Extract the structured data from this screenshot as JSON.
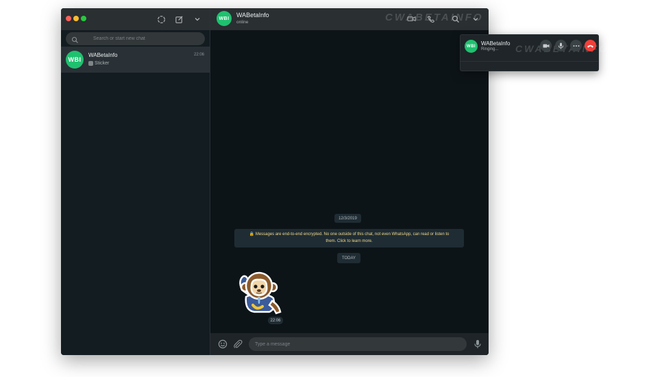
{
  "sidebar": {
    "search_placeholder": "Search or start new chat",
    "chats": [
      {
        "avatar_text": "WBI",
        "name": "WABetaInfo",
        "time": "22:06",
        "last_message": "Sticker"
      }
    ]
  },
  "chat": {
    "avatar_text": "WBI",
    "name": "WABetaInfo",
    "status": "online",
    "watermark": "CWABETAINFO",
    "date_label": "12/3/2019",
    "encryption_notice_line1": "Messages are end-to-end encrypted. No one outside of this chat, not even WhatsApp, can read or listen to",
    "encryption_notice_line2": "them. Click to learn more.",
    "today_label": "TODAY",
    "sticker_time": "22:06",
    "input_placeholder": "Type a message"
  },
  "call_popup": {
    "avatar_text": "WBI",
    "name": "WABetaInfo",
    "status": "Ringing...",
    "watermark": "CWABETAINFO"
  },
  "colors": {
    "accent_green": "#1fc16f",
    "end_call_red": "#f03f3a",
    "encryption_text": "#f0d88c"
  },
  "icons": {
    "sidebar_header": [
      "status-icon",
      "new-chat-icon",
      "menu-chevron-icon"
    ],
    "chat_header": [
      "video-call-icon",
      "voice-call-icon",
      "search-icon",
      "menu-chevron-icon"
    ],
    "footer": [
      "emoji-icon",
      "attach-icon",
      "microphone-icon"
    ],
    "call_popup": [
      "video-icon",
      "mute-icon",
      "more-icon",
      "end-call-icon"
    ]
  }
}
